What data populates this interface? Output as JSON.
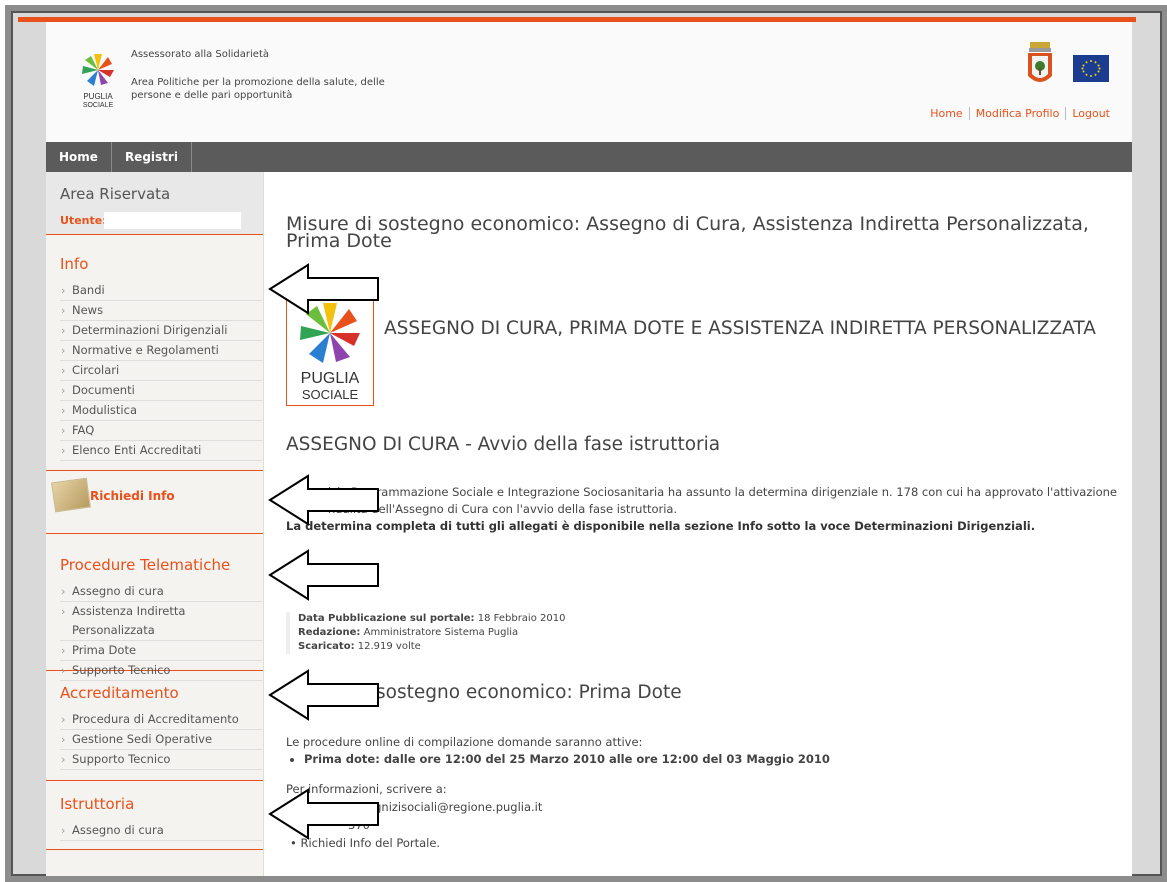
{
  "header": {
    "assessorato": "Assessorato alla Solidarietà",
    "area_line1": "Area Politiche per la promozione della salute, delle",
    "area_line2": "persone e delle pari opportunità",
    "logo_text1": "PUGLIA",
    "logo_text2": "SOCIALE",
    "links": [
      "Home",
      "Modifica Profilo",
      "Logout"
    ]
  },
  "nav": {
    "items": [
      "Home",
      "Registri"
    ]
  },
  "sidebar": {
    "area_title": "Area Riservata",
    "user_label": "Utente:",
    "user_value": "",
    "info": {
      "title": "Info",
      "items": [
        "Bandi",
        "News",
        "Determinazioni Dirigenziali",
        "Normative e Regolamenti",
        "Circolari",
        "Documenti",
        "Modulistica",
        "FAQ",
        "Elenco Enti Accreditati"
      ]
    },
    "richiedi": "Richiedi Info",
    "procedure": {
      "title": "Procedure Telematiche",
      "items": [
        "Assegno di cura",
        "Assistenza Indiretta Personalizzata",
        "Prima Dote",
        "Supporto Tecnico"
      ]
    },
    "accreditamento": {
      "title": "Accreditamento",
      "items": [
        "Procedura di Accreditamento",
        "Gestione Sedi Operative",
        "Supporto Tecnico"
      ]
    },
    "istruttoria": {
      "title": "Istruttoria",
      "items": [
        "Assegno di cura"
      ]
    }
  },
  "content": {
    "title": "Misure di sostegno economico: Assegno di Cura, Assistenza Indiretta Personalizzata, Prima Dote",
    "big_title": "ASSEGNO DI CURA, PRIMA DOTE E ASSISTENZA INDIRETTA PERSONALIZZATA",
    "section1_title": "ASSEGNO DI CURA - Avvio della fase istruttoria",
    "para1_a": "Servizio Programmazione Sociale e Integrazione Sociosanitaria ha assunto la determina dirigenziale n. 178 con cui ha approvato l'attivazione",
    "para1_b": "nualità dell'Assegno di Cura con l'avvio della fase istruttoria.",
    "para1_bold": "La determina completa di tutti gli allegati è disponibile nella sezione Info sotto la voce Determinazioni Dirigenziali.",
    "meta_label1": "Data Pubblicazione sul portale:",
    "meta_value1": "18 Febbraio 2010",
    "meta_label2": "Redazione:",
    "meta_value2": "Amministratore Sistema Puglia",
    "meta_label3": "Scaricato:",
    "meta_value3": "12.919 volte",
    "section2_title": "sostegno economico: Prima Dote",
    "procedure_intro": "Le procedure online di compilazione domande saranno attive:",
    "procedure_bullet": "Prima dote: dalle ore 12:00 del 25 Marzo 2010 alle ore 12:00 del 03 Maggio 2010",
    "info_intro": "Per informazioni, scrivere a:",
    "info_email": "assegnizisociali@regione.puglia.it",
    "info_phone": "370",
    "info_last": "Richiedi Info del Portale."
  },
  "colors": {
    "accent": "#e8511a",
    "nav_bg": "#5b5b5b",
    "eu_blue": "#1c3d8f"
  }
}
